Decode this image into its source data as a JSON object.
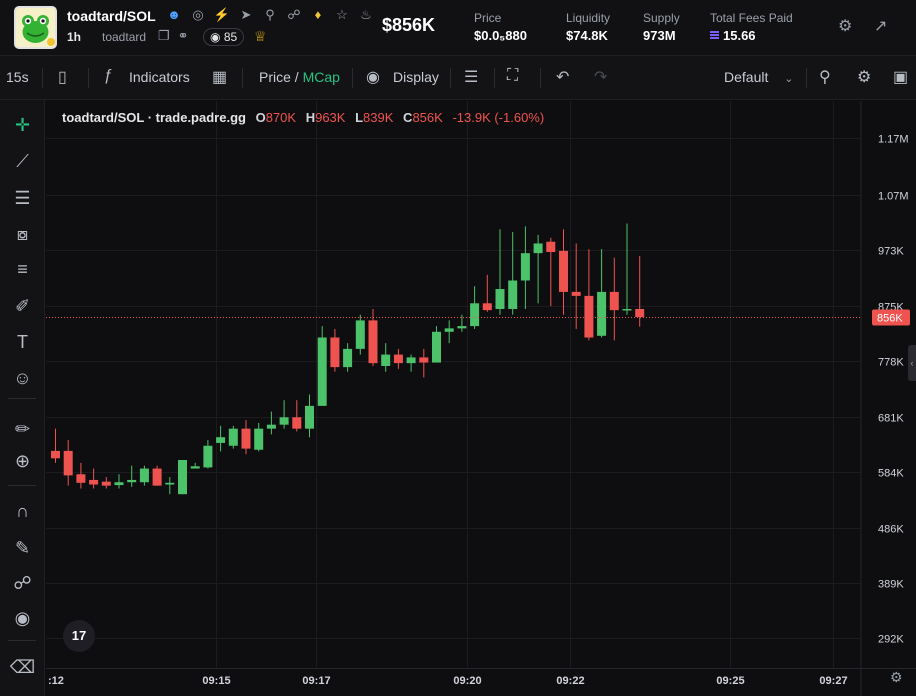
{
  "header": {
    "token_name": "toadtard/SOL",
    "age": "1h",
    "ticker": "toadtard",
    "watchers": "85",
    "market_cap": "$856K",
    "stats": [
      {
        "label": "Price",
        "value": "$0.0₅880"
      },
      {
        "label": "Liquidity",
        "value": "$74.8K"
      },
      {
        "label": "Supply",
        "value": "973M"
      },
      {
        "label": "Total Fees Paid",
        "value": "15.66"
      }
    ],
    "icons": [
      "person-icon",
      "globe-icon",
      "bolt-icon",
      "telegram-icon",
      "search-icon",
      "link-icon",
      "badge-icon",
      "star-icon",
      "bell-icon"
    ]
  },
  "toolbar": {
    "interval": "15s",
    "indicators": "Indicators",
    "price_label": "Price",
    "slash": "/",
    "mcap_label": "MCap",
    "display_label": "Display",
    "layout": "Default"
  },
  "legend": {
    "pair": "toadtard/SOL · trade.padre.gg",
    "o_label": "O",
    "o": "870K",
    "h_label": "H",
    "h": "963K",
    "l_label": "L",
    "l": "839K",
    "c_label": "C",
    "c": "856K",
    "change": "-13.9K (-1.60%)"
  },
  "tv_logo": "17",
  "colors": {
    "up": "#26a69a",
    "up_body": "#4cc26a",
    "down": "#ef5350",
    "background": "#0e0e10",
    "grid": "#1b1b20",
    "accent": "#26c281",
    "last_price": "#ef5350"
  },
  "chart_data": {
    "type": "candlestick",
    "title": "toadtard/SOL · trade.padre.gg",
    "y_unit": "market cap (USD)",
    "ylim": [
      240000,
      1235000
    ],
    "y_ticks": [
      "1.17M",
      "1.07M",
      "973K",
      "875K",
      "778K",
      "681K",
      "584K",
      "486K",
      "389K",
      "292K"
    ],
    "y_tick_values": [
      1170000,
      1070000,
      973000,
      875000,
      778000,
      681000,
      584000,
      486000,
      389000,
      292000
    ],
    "x_ticks": [
      ":12",
      "09:15",
      "09:17",
      "09:20",
      "09:22",
      "09:25",
      "09:27"
    ],
    "x_tick_index": [
      0,
      12.6,
      20.5,
      32.4,
      40.5,
      53.1,
      61.2
    ],
    "last_price": {
      "label": "856K",
      "value": 856000
    },
    "grid": true,
    "candles": [
      {
        "o": 621000,
        "h": 660000,
        "l": 600000,
        "c": 608000
      },
      {
        "o": 621000,
        "h": 640000,
        "l": 560000,
        "c": 578000
      },
      {
        "o": 580000,
        "h": 600000,
        "l": 555000,
        "c": 565000
      },
      {
        "o": 570000,
        "h": 590000,
        "l": 555000,
        "c": 562000
      },
      {
        "o": 567000,
        "h": 575000,
        "l": 555000,
        "c": 560000
      },
      {
        "o": 561000,
        "h": 580000,
        "l": 555000,
        "c": 566000
      },
      {
        "o": 566000,
        "h": 595000,
        "l": 558000,
        "c": 570000
      },
      {
        "o": 566000,
        "h": 595000,
        "l": 560000,
        "c": 590000
      },
      {
        "o": 590000,
        "h": 595000,
        "l": 560000,
        "c": 560000
      },
      {
        "o": 562000,
        "h": 575000,
        "l": 545000,
        "c": 565000
      },
      {
        "o": 545000,
        "h": 605000,
        "l": 545000,
        "c": 605000
      },
      {
        "o": 590000,
        "h": 600000,
        "l": 590000,
        "c": 594000
      },
      {
        "o": 592000,
        "h": 640000,
        "l": 590000,
        "c": 630000
      },
      {
        "o": 635000,
        "h": 665000,
        "l": 620000,
        "c": 645000
      },
      {
        "o": 630000,
        "h": 665000,
        "l": 625000,
        "c": 660000
      },
      {
        "o": 660000,
        "h": 675000,
        "l": 615000,
        "c": 625000
      },
      {
        "o": 623000,
        "h": 670000,
        "l": 620000,
        "c": 660000
      },
      {
        "o": 660000,
        "h": 690000,
        "l": 650000,
        "c": 667000
      },
      {
        "o": 667000,
        "h": 710000,
        "l": 660000,
        "c": 680000
      },
      {
        "o": 680000,
        "h": 710000,
        "l": 655000,
        "c": 660000
      },
      {
        "o": 660000,
        "h": 720000,
        "l": 645000,
        "c": 700000
      },
      {
        "o": 700000,
        "h": 840000,
        "l": 700000,
        "c": 820000
      },
      {
        "o": 820000,
        "h": 835000,
        "l": 760000,
        "c": 768000
      },
      {
        "o": 768000,
        "h": 810000,
        "l": 760000,
        "c": 800000
      },
      {
        "o": 800000,
        "h": 860000,
        "l": 790000,
        "c": 850000
      },
      {
        "o": 850000,
        "h": 870000,
        "l": 770000,
        "c": 775000
      },
      {
        "o": 770000,
        "h": 810000,
        "l": 760000,
        "c": 790000
      },
      {
        "o": 790000,
        "h": 800000,
        "l": 765000,
        "c": 775000
      },
      {
        "o": 775000,
        "h": 790000,
        "l": 760000,
        "c": 785000
      },
      {
        "o": 785000,
        "h": 800000,
        "l": 750000,
        "c": 776000
      },
      {
        "o": 776000,
        "h": 840000,
        "l": 776000,
        "c": 830000
      },
      {
        "o": 830000,
        "h": 850000,
        "l": 810000,
        "c": 836000
      },
      {
        "o": 836000,
        "h": 860000,
        "l": 830000,
        "c": 840000
      },
      {
        "o": 840000,
        "h": 910000,
        "l": 835000,
        "c": 880000
      },
      {
        "o": 880000,
        "h": 930000,
        "l": 865000,
        "c": 868000
      },
      {
        "o": 870000,
        "h": 1010000,
        "l": 860000,
        "c": 905000
      },
      {
        "o": 870000,
        "h": 1005000,
        "l": 860000,
        "c": 920000
      },
      {
        "o": 920000,
        "h": 1015000,
        "l": 870000,
        "c": 968000
      },
      {
        "o": 968000,
        "h": 1000000,
        "l": 880000,
        "c": 985000
      },
      {
        "o": 988000,
        "h": 995000,
        "l": 875000,
        "c": 970000
      },
      {
        "o": 972000,
        "h": 1010000,
        "l": 860000,
        "c": 900000
      },
      {
        "o": 900000,
        "h": 985000,
        "l": 835000,
        "c": 893000
      },
      {
        "o": 893000,
        "h": 975000,
        "l": 815000,
        "c": 820000
      },
      {
        "o": 823000,
        "h": 975000,
        "l": 820000,
        "c": 900000
      },
      {
        "o": 900000,
        "h": 960000,
        "l": 815000,
        "c": 868000
      },
      {
        "o": 868000,
        "h": 1020000,
        "l": 860000,
        "c": 870000
      },
      {
        "o": 870000,
        "h": 963000,
        "l": 839000,
        "c": 856000
      }
    ]
  }
}
